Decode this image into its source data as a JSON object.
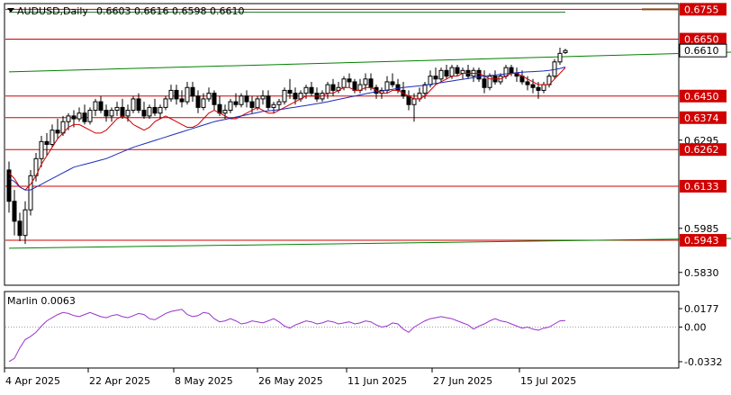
{
  "header": {
    "symbol_label": "AUDUSD,Daily",
    "ohlc_text": "0.6603 0.6616 0.6598 0.6610"
  },
  "indicator": {
    "label": "Marlin 0.0063",
    "axis_ticks": [
      "0.0177",
      "0.00",
      "-0.0332"
    ]
  },
  "chart_data": [
    {
      "type": "candlestick",
      "title": "AUDUSD,Daily",
      "ohlc_last": {
        "open": 0.6603,
        "high": 0.6616,
        "low": 0.6598,
        "close": 0.661
      },
      "x_tick_labels": [
        "4 Apr 2025",
        "22 Apr 2025",
        "8 May 2025",
        "26 May 2025",
        "11 Jun 2025",
        "27 Jun 2025",
        "15 Jul 2025"
      ],
      "y_tick_labels": [
        "0.6755",
        "0.6650",
        "0.6610",
        "0.6450",
        "0.6374",
        "0.6295",
        "0.6262",
        "0.6133",
        "0.5985",
        "0.5943",
        "0.5830"
      ],
      "ylim": [
        0.5785,
        0.6775
      ],
      "grid": false,
      "level_lines": [
        0.6755,
        0.665,
        0.645,
        0.6374,
        0.6262,
        0.6133,
        0.5943
      ],
      "level_line_color": "#d00000",
      "current_price": 0.661,
      "channel_upper": {
        "color": "#008000",
        "points": [
          [
            0,
            0.6535
          ],
          [
            135,
            0.6605
          ]
        ]
      },
      "channel_lower": {
        "color": "#008000",
        "points": [
          [
            0,
            0.5915
          ],
          [
            135,
            0.595
          ]
        ]
      },
      "ceiling_line": {
        "color": "#2e7d32",
        "value": 0.6745
      },
      "ceiling_segment": {
        "color": "#8b4513",
        "value": 0.6755
      },
      "candles": [
        [
          0.619,
          0.622,
          0.604,
          0.608
        ],
        [
          0.608,
          0.612,
          0.596,
          0.601
        ],
        [
          0.601,
          0.604,
          0.594,
          0.596
        ],
        [
          0.596,
          0.608,
          0.593,
          0.605
        ],
        [
          0.605,
          0.619,
          0.603,
          0.617
        ],
        [
          0.617,
          0.625,
          0.615,
          0.623
        ],
        [
          0.623,
          0.631,
          0.62,
          0.629
        ],
        [
          0.629,
          0.632,
          0.624,
          0.628
        ],
        [
          0.628,
          0.635,
          0.627,
          0.633
        ],
        [
          0.633,
          0.637,
          0.63,
          0.632
        ],
        [
          0.632,
          0.638,
          0.631,
          0.636
        ],
        [
          0.636,
          0.639,
          0.633,
          0.638
        ],
        [
          0.638,
          0.64,
          0.634,
          0.637
        ],
        [
          0.637,
          0.641,
          0.636,
          0.639
        ],
        [
          0.639,
          0.642,
          0.635,
          0.636
        ],
        [
          0.636,
          0.641,
          0.635,
          0.64
        ],
        [
          0.64,
          0.644,
          0.638,
          0.643
        ],
        [
          0.643,
          0.645,
          0.639,
          0.64
        ],
        [
          0.64,
          0.642,
          0.636,
          0.638
        ],
        [
          0.638,
          0.641,
          0.636,
          0.64
        ],
        [
          0.64,
          0.643,
          0.638,
          0.641
        ],
        [
          0.641,
          0.644,
          0.637,
          0.638
        ],
        [
          0.638,
          0.642,
          0.636,
          0.64
        ],
        [
          0.64,
          0.645,
          0.639,
          0.644
        ],
        [
          0.644,
          0.646,
          0.639,
          0.64
        ],
        [
          0.64,
          0.643,
          0.637,
          0.638
        ],
        [
          0.638,
          0.642,
          0.637,
          0.641
        ],
        [
          0.641,
          0.644,
          0.638,
          0.639
        ],
        [
          0.639,
          0.642,
          0.637,
          0.641
        ],
        [
          0.641,
          0.645,
          0.64,
          0.644
        ],
        [
          0.644,
          0.649,
          0.643,
          0.647
        ],
        [
          0.647,
          0.649,
          0.642,
          0.644
        ],
        [
          0.644,
          0.647,
          0.641,
          0.643
        ],
        [
          0.643,
          0.65,
          0.642,
          0.648
        ],
        [
          0.648,
          0.65,
          0.643,
          0.645
        ],
        [
          0.645,
          0.647,
          0.639,
          0.641
        ],
        [
          0.641,
          0.646,
          0.64,
          0.644
        ],
        [
          0.644,
          0.648,
          0.643,
          0.646
        ],
        [
          0.646,
          0.647,
          0.64,
          0.642
        ],
        [
          0.642,
          0.645,
          0.638,
          0.639
        ],
        [
          0.639,
          0.642,
          0.637,
          0.64
        ],
        [
          0.64,
          0.644,
          0.639,
          0.643
        ],
        [
          0.643,
          0.646,
          0.641,
          0.642
        ],
        [
          0.642,
          0.646,
          0.641,
          0.645
        ],
        [
          0.645,
          0.647,
          0.641,
          0.643
        ],
        [
          0.643,
          0.645,
          0.639,
          0.641
        ],
        [
          0.641,
          0.645,
          0.64,
          0.644
        ],
        [
          0.644,
          0.647,
          0.642,
          0.645
        ],
        [
          0.645,
          0.647,
          0.64,
          0.641
        ],
        [
          0.641,
          0.643,
          0.639,
          0.642
        ],
        [
          0.642,
          0.644,
          0.64,
          0.643
        ],
        [
          0.643,
          0.648,
          0.642,
          0.647
        ],
        [
          0.647,
          0.651,
          0.644,
          0.646
        ],
        [
          0.646,
          0.648,
          0.642,
          0.644
        ],
        [
          0.644,
          0.647,
          0.643,
          0.646
        ],
        [
          0.646,
          0.649,
          0.644,
          0.648
        ],
        [
          0.648,
          0.65,
          0.645,
          0.646
        ],
        [
          0.646,
          0.648,
          0.643,
          0.644
        ],
        [
          0.644,
          0.647,
          0.643,
          0.646
        ],
        [
          0.646,
          0.65,
          0.644,
          0.649
        ],
        [
          0.649,
          0.651,
          0.645,
          0.647
        ],
        [
          0.647,
          0.65,
          0.646,
          0.648
        ],
        [
          0.648,
          0.652,
          0.647,
          0.651
        ],
        [
          0.651,
          0.653,
          0.648,
          0.65
        ],
        [
          0.65,
          0.651,
          0.646,
          0.647
        ],
        [
          0.647,
          0.651,
          0.646,
          0.649
        ],
        [
          0.649,
          0.653,
          0.647,
          0.651
        ],
        [
          0.651,
          0.653,
          0.647,
          0.648
        ],
        [
          0.648,
          0.649,
          0.644,
          0.646
        ],
        [
          0.646,
          0.648,
          0.644,
          0.647
        ],
        [
          0.647,
          0.652,
          0.646,
          0.65
        ],
        [
          0.65,
          0.653,
          0.648,
          0.649
        ],
        [
          0.649,
          0.651,
          0.646,
          0.647
        ],
        [
          0.647,
          0.65,
          0.644,
          0.645
        ],
        [
          0.645,
          0.647,
          0.64,
          0.642
        ],
        [
          0.642,
          0.646,
          0.636,
          0.644
        ],
        [
          0.644,
          0.648,
          0.643,
          0.646
        ],
        [
          0.646,
          0.65,
          0.644,
          0.649
        ],
        [
          0.649,
          0.654,
          0.648,
          0.652
        ],
        [
          0.652,
          0.655,
          0.649,
          0.651
        ],
        [
          0.651,
          0.655,
          0.65,
          0.654
        ],
        [
          0.654,
          0.656,
          0.651,
          0.652
        ],
        [
          0.652,
          0.656,
          0.651,
          0.655
        ],
        [
          0.655,
          0.656,
          0.652,
          0.653
        ],
        [
          0.653,
          0.655,
          0.651,
          0.654
        ],
        [
          0.654,
          0.656,
          0.651,
          0.652
        ],
        [
          0.652,
          0.655,
          0.65,
          0.654
        ],
        [
          0.654,
          0.655,
          0.65,
          0.651
        ],
        [
          0.651,
          0.654,
          0.646,
          0.648
        ],
        [
          0.648,
          0.653,
          0.647,
          0.652
        ],
        [
          0.652,
          0.654,
          0.649,
          0.65
        ],
        [
          0.65,
          0.653,
          0.649,
          0.652
        ],
        [
          0.652,
          0.656,
          0.651,
          0.655
        ],
        [
          0.655,
          0.656,
          0.652,
          0.653
        ],
        [
          0.653,
          0.655,
          0.65,
          0.652
        ],
        [
          0.652,
          0.654,
          0.649,
          0.65
        ],
        [
          0.65,
          0.652,
          0.647,
          0.649
        ],
        [
          0.649,
          0.651,
          0.646,
          0.648
        ],
        [
          0.648,
          0.65,
          0.644,
          0.647
        ],
        [
          0.647,
          0.65,
          0.646,
          0.649
        ],
        [
          0.649,
          0.653,
          0.648,
          0.652
        ],
        [
          0.652,
          0.658,
          0.651,
          0.657
        ],
        [
          0.657,
          0.662,
          0.656,
          0.66
        ],
        [
          0.6603,
          0.6616,
          0.6598,
          0.661
        ]
      ],
      "series": [
        {
          "name": "",
          "color": "#d00000",
          "values": [
            0.618,
            0.616,
            0.613,
            0.612,
            0.614,
            0.617,
            0.621,
            0.624,
            0.627,
            0.63,
            0.632,
            0.634,
            0.635,
            0.635,
            0.634,
            0.633,
            0.632,
            0.632,
            0.633,
            0.635,
            0.637,
            0.638,
            0.637,
            0.635,
            0.634,
            0.633,
            0.634,
            0.636,
            0.637,
            0.638,
            0.637,
            0.636,
            0.635,
            0.634,
            0.634,
            0.635,
            0.637,
            0.639,
            0.64,
            0.639,
            0.638,
            0.637,
            0.637,
            0.638,
            0.639,
            0.64,
            0.641,
            0.64,
            0.639,
            0.639,
            0.64,
            0.641,
            0.642,
            0.643,
            0.644,
            0.645,
            0.645,
            0.645,
            0.645,
            0.646,
            0.646,
            0.647,
            0.648,
            0.648,
            0.647,
            0.647,
            0.648,
            0.648,
            0.647,
            0.646,
            0.646,
            0.647,
            0.647,
            0.646,
            0.645,
            0.644,
            0.644,
            0.645,
            0.647,
            0.649,
            0.65,
            0.651,
            0.652,
            0.652,
            0.653,
            0.653,
            0.653,
            0.653,
            0.652,
            0.651,
            0.651,
            0.651,
            0.652,
            0.653,
            0.653,
            0.652,
            0.651,
            0.65,
            0.649,
            0.649,
            0.649,
            0.651,
            0.653,
            0.655
          ]
        },
        {
          "name": "",
          "color": "#1c2bb8",
          "values": [
            0.616,
            0.615,
            0.613,
            0.612,
            0.612,
            0.613,
            0.614,
            0.615,
            0.616,
            0.617,
            0.618,
            0.619,
            0.62,
            0.6205,
            0.621,
            0.6215,
            0.622,
            0.6225,
            0.623,
            0.6238,
            0.6246,
            0.6254,
            0.6262,
            0.627,
            0.6276,
            0.6282,
            0.6288,
            0.6294,
            0.63,
            0.6306,
            0.6312,
            0.6318,
            0.6324,
            0.633,
            0.6336,
            0.6342,
            0.6348,
            0.6354,
            0.636,
            0.6364,
            0.6368,
            0.6372,
            0.6376,
            0.638,
            0.6384,
            0.6388,
            0.6392,
            0.6396,
            0.6398,
            0.64,
            0.6402,
            0.6405,
            0.6408,
            0.6411,
            0.6414,
            0.6417,
            0.642,
            0.6423,
            0.6426,
            0.643,
            0.6434,
            0.6438,
            0.6442,
            0.6446,
            0.645,
            0.6454,
            0.6458,
            0.6462,
            0.6465,
            0.6468,
            0.6471,
            0.6474,
            0.6477,
            0.648,
            0.6482,
            0.6484,
            0.6486,
            0.6488,
            0.6491,
            0.6494,
            0.6497,
            0.65,
            0.6503,
            0.6506,
            0.6509,
            0.6512,
            0.6515,
            0.6518,
            0.652,
            0.6522,
            0.6524,
            0.6526,
            0.6528,
            0.653,
            0.6532,
            0.6534,
            0.6535,
            0.6536,
            0.6537,
            0.6538,
            0.654,
            0.6543,
            0.6547,
            0.6552
          ]
        }
      ]
    },
    {
      "type": "line",
      "title": "Marlin 0.0063",
      "ylim": [
        -0.0332,
        0.0177
      ],
      "y_tick_labels": [
        "0.0177",
        "0.00",
        "-0.0332"
      ],
      "zero_line": 0.0,
      "series": [
        {
          "name": "",
          "color": "#9932cc",
          "values": [
            -0.033,
            -0.03,
            -0.02,
            -0.012,
            -0.009,
            -0.005,
            0.001,
            0.006,
            0.009,
            0.012,
            0.014,
            0.013,
            0.011,
            0.01,
            0.012,
            0.014,
            0.012,
            0.01,
            0.009,
            0.011,
            0.012,
            0.01,
            0.009,
            0.011,
            0.013,
            0.012,
            0.008,
            0.007,
            0.01,
            0.013,
            0.015,
            0.016,
            0.017,
            0.012,
            0.01,
            0.011,
            0.014,
            0.013,
            0.008,
            0.005,
            0.006,
            0.008,
            0.006,
            0.003,
            0.004,
            0.006,
            0.005,
            0.004,
            0.006,
            0.008,
            0.005,
            0.001,
            -0.001,
            0.002,
            0.004,
            0.006,
            0.005,
            0.003,
            0.004,
            0.006,
            0.005,
            0.003,
            0.004,
            0.005,
            0.003,
            0.004,
            0.006,
            0.005,
            0.002,
            0.0,
            0.001,
            0.004,
            0.003,
            -0.002,
            -0.005,
            0.0,
            0.003,
            0.006,
            0.008,
            0.009,
            0.01,
            0.009,
            0.008,
            0.006,
            0.004,
            0.002,
            -0.002,
            0.001,
            0.003,
            0.006,
            0.008,
            0.006,
            0.005,
            0.003,
            0.001,
            -0.001,
            0.0,
            -0.002,
            -0.003,
            -0.001,
            0.0,
            0.003,
            0.006,
            0.0063
          ]
        }
      ]
    }
  ]
}
